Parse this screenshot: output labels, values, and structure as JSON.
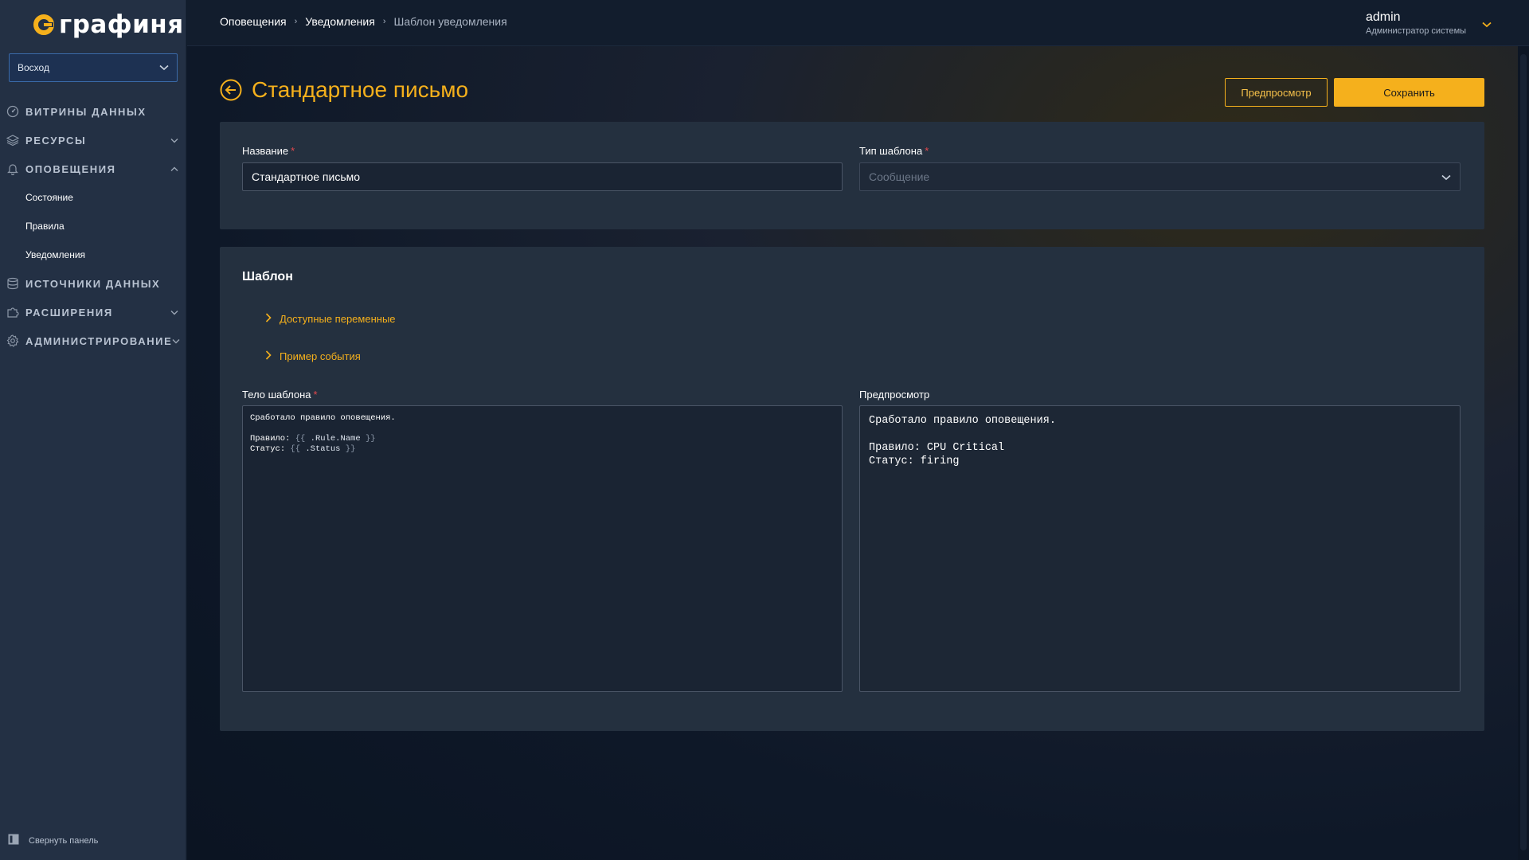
{
  "app": {
    "logo_text": "графиня"
  },
  "sidebar": {
    "org_select": "Восход",
    "items": [
      {
        "label": "Витрины данных",
        "icon": "dashboard-icon",
        "has_chevron": false
      },
      {
        "label": "Ресурсы",
        "icon": "layers-icon",
        "has_chevron": true,
        "expanded": false
      },
      {
        "label": "Оповещения",
        "icon": "bell-icon",
        "has_chevron": true,
        "expanded": true
      },
      {
        "label": "Источники данных",
        "icon": "database-icon",
        "has_chevron": false
      },
      {
        "label": "Расширения",
        "icon": "puzzle-icon",
        "has_chevron": true,
        "expanded": false
      },
      {
        "label": "Администрирование",
        "icon": "gear-icon",
        "has_chevron": true,
        "expanded": false
      }
    ],
    "alert_subitems": [
      "Состояние",
      "Правила",
      "Уведомления"
    ],
    "collapse_label": "Свернуть панель"
  },
  "header": {
    "breadcrumb": [
      "Оповещения",
      "Уведомления",
      "Шаблон уведомления"
    ],
    "user_name": "admin",
    "user_role": "Администратор системы"
  },
  "page": {
    "title": "Стандартное письмо",
    "preview_button": "Предпросмотр",
    "save_button": "Сохранить"
  },
  "form": {
    "name_label": "Название",
    "name_value": "Стандартное письмо",
    "type_label": "Тип шаблона",
    "type_placeholder": "Сообщение"
  },
  "template": {
    "section_title": "Шаблон",
    "available_vars": "Доступные переменные",
    "event_example": "Пример события",
    "body_label": "Тело шаблона",
    "body_lines": {
      "l1": "Сработало правило оповещения.",
      "l2_prefix": "Правило",
      "l2_var": ".Rule.Name",
      "l3_prefix": "Статус",
      "l3_var": ".Status"
    },
    "preview_label": "Предпросмотр",
    "preview_lines": [
      "Сработало правило оповещения.",
      "",
      "Правило: CPU Critical",
      "Статус: firing"
    ]
  },
  "colors": {
    "accent": "#f5b01c",
    "required": "#e5484d",
    "sidebar_bg": "#233044",
    "card_bg": "#24303f"
  }
}
